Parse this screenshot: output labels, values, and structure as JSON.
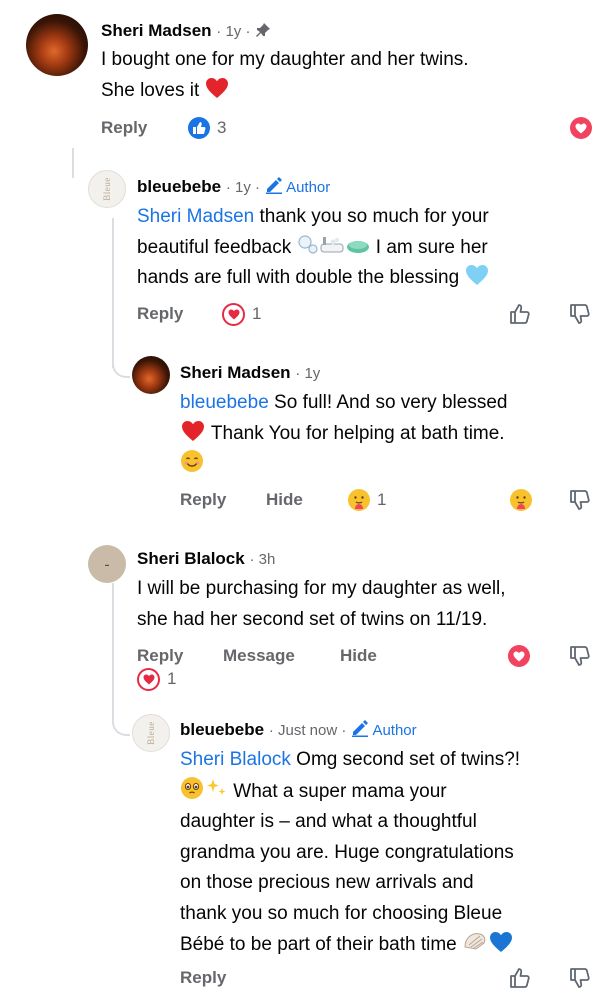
{
  "comments": [
    {
      "name": "Sheri Madsen",
      "meta": "· 1y ·",
      "lines": [
        "I bought one for my daughter and her twins.",
        "She loves it"
      ],
      "reply_label": "Reply",
      "like_count": "3"
    },
    {
      "name": "bleuebebe",
      "meta": "· 1y ·",
      "author_label": "Author",
      "mention": "Sheri Madsen",
      "line1_rest": " thank you so much for your",
      "line2": "beautiful feedback",
      "line2_rest": " I am sure her",
      "line3": "hands are full with double the blessing",
      "reply_label": "Reply",
      "reaction_count": "1",
      "avatar_text": "Bleue"
    },
    {
      "name": "Sheri Madsen",
      "meta": "· 1y",
      "mention": "bleuebebe",
      "line1_rest": " So full!  And so very blessed",
      "line2": " Thank You for helping at bath time.",
      "reply_label": "Reply",
      "hide_label": "Hide",
      "reaction_count": "1"
    },
    {
      "name": "Sheri Blalock",
      "meta": "· 3h",
      "lines": [
        "I will be purchasing for my daughter as well,",
        "she had her second set of twins on 11/19."
      ],
      "reply_label": "Reply",
      "message_label": "Message",
      "hide_label": "Hide",
      "reaction_count": "1"
    },
    {
      "name": "bleuebebe",
      "meta": "· Just now ·",
      "author_label": "Author",
      "mention": "Sheri Blalock",
      "line1_rest": " Omg second set of twins?!",
      "line2_rest": " What a super mama your",
      "lines": [
        "daughter is – and what a thoughtful",
        "grandma you are. Huge congratulations",
        "on those precious new arrivals and",
        "thank you so much for choosing Bleue"
      ],
      "last_line": "Bébé to be part of their bath time",
      "reply_label": "Reply",
      "avatar_text": "Bleue"
    }
  ],
  "icons": [
    "pin-icon",
    "pencil-icon",
    "like-icon",
    "heart-icon",
    "thumbs-up-outline-icon",
    "thumbs-down-outline-icon",
    "care-emoji-icon",
    "smile-emoji-icon",
    "crying-smile-emoji-icon",
    "sparkles-icon",
    "heart-emoji-icon",
    "light-blue-heart-emoji-icon",
    "blue-heart-emoji-icon",
    "shell-emoji-icon",
    "bubbles-emoji-icon",
    "bathtub-emoji-icon",
    "soap-emoji-icon"
  ],
  "colors": {
    "link": "#1b74e4",
    "love": "#f3425f",
    "muted": "#65676b"
  }
}
